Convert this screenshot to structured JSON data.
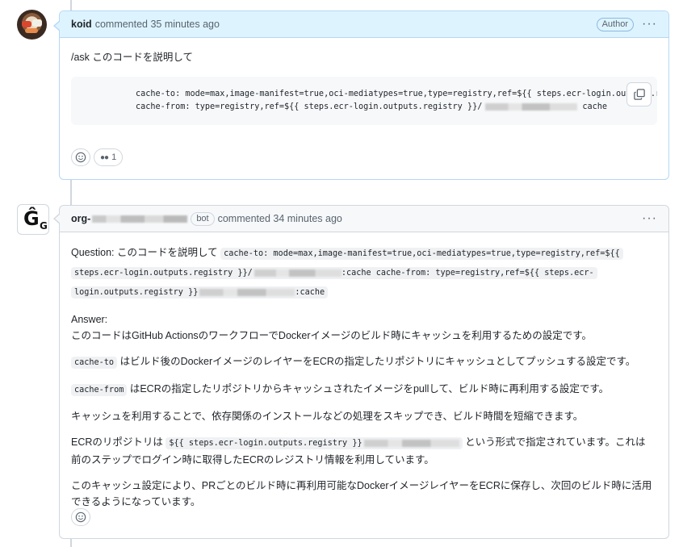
{
  "comment1": {
    "author": "koid",
    "time": "commented 35 minutes ago",
    "badge": "Author",
    "more": "···",
    "prompt": "/ask このコードを説明して",
    "code_line1": "cache-to: mode=max,image-manifest=true,oci-mediatypes=true,type=registry,ref=${{ steps.ecr-login.outputs.registry }}/",
    "code_line2_a": "cache-from: type=registry,ref=${{ steps.ecr-login.outputs.registry }}/",
    "code_line2_b": "cache",
    "reaction_count": "1"
  },
  "comment2": {
    "author": "org-",
    "bot_label": "bot",
    "time": "commented 34 minutes ago",
    "more": "···",
    "question_label": "Question: このコードを説明して",
    "q_code1": "cache-to: mode=max,image-manifest=true,oci-mediatypes=true,type=registry,ref=${{",
    "q_code2": "steps.ecr-login.outputs.registry }}/",
    "q_code3": ":cache cache-from: type=registry,ref=${{ steps.ecr-",
    "q_code4": "login.outputs.registry }}",
    "q_code5": ":cache",
    "answer_label": "Answer:",
    "answer_p1": "このコードはGitHub ActionsのワークフローでDockerイメージのビルド時にキャッシュを利用するための設定です。",
    "p2_code": "cache-to",
    "p2_text": "はビルド後のDockerイメージのレイヤーをECRの指定したリポジトリにキャッシュとしてプッシュする設定です。",
    "p3_code": "cache-from",
    "p3_text": "はECRの指定したリポジトリからキャッシュされたイメージをpullして、ビルド時に再利用する設定です。",
    "p4": "キャッシュを利用することで、依存関係のインストールなどの処理をスキップでき、ビルド時間を短縮できます。",
    "p5_a": "ECRのリポジトリは",
    "p5_code": "${{ steps.ecr-login.outputs.registry }}",
    "p5_b": "という形式で指定されています。これは",
    "p5_c": "前のステップでログイン時に取得したECRのレジストリ情報を利用しています。",
    "p6": "このキャッシュ設定により、PRごとのビルド時に再利用可能なDockerイメージレイヤーをECRに保存し、次回のビルド時に活用できるようになっています。"
  }
}
